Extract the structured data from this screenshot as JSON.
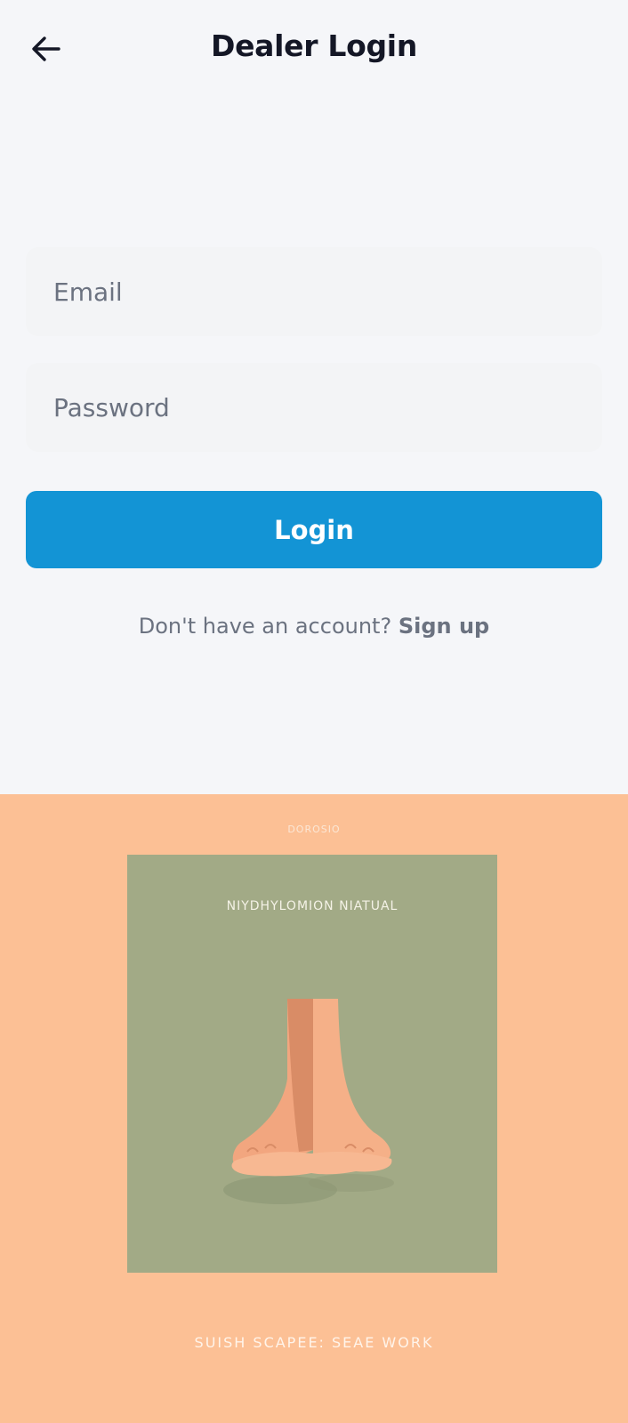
{
  "header": {
    "back_icon": "arrow-left-icon",
    "title": "Dealer Login"
  },
  "form": {
    "email_placeholder": "Email",
    "email_value": "",
    "password_placeholder": "Password",
    "password_value": "",
    "login_label": "Login"
  },
  "signup": {
    "prompt": "Don't have an account? ",
    "link_label": "Sign up"
  },
  "artwork": {
    "top_text": "DOROSIO",
    "inner_text": "NIYDHYLOMION NIATUAL",
    "bottom_text": "SUISH SCAPEE: SEAE WORK"
  },
  "colors": {
    "background": "#f5f6f9",
    "field": "#f3f4f6",
    "primary": "#1394d5",
    "art_background": "#fcc095",
    "art_panel": "#a2aa86"
  }
}
